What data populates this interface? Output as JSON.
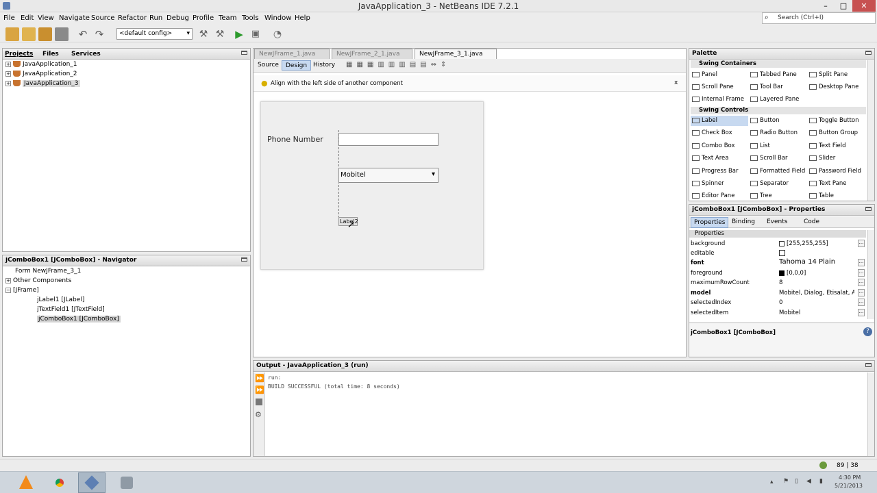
{
  "window": {
    "title": "JavaApplication_3 - NetBeans IDE 7.2.1",
    "min": "–",
    "max": "□",
    "close": "✕"
  },
  "menu": [
    "File",
    "Edit",
    "View",
    "Navigate",
    "Source",
    "Refactor",
    "Run",
    "Debug",
    "Profile",
    "Team",
    "Tools",
    "Window",
    "Help"
  ],
  "search": {
    "placeholder": "Search (Ctrl+I)"
  },
  "toolbar": {
    "config": "<default config>"
  },
  "projects": {
    "tabs": [
      "Projects",
      "Files",
      "Services"
    ],
    "items": [
      "JavaApplication_1",
      "JavaApplication_2",
      "JavaApplication_3"
    ]
  },
  "editor": {
    "tabs": [
      "NewJFrame_1.java",
      "NewJFrame_2_1.java",
      "NewJFrame_3_1.java"
    ],
    "modes": [
      "Source",
      "Design",
      "History"
    ],
    "hint": "Align with the left side of another component",
    "hint_close": "x",
    "form": {
      "phone_label": "Phone Number",
      "combo_value": "Mobitel",
      "label2": "Label2"
    }
  },
  "navigator": {
    "title": "jComboBox1 [JComboBox] - Navigator",
    "items": [
      "Form NewJFrame_3_1",
      "Other Components",
      "[JFrame]",
      "jLabel1 [JLabel]",
      "jTextField1 [JTextField]",
      "jComboBox1 [JComboBox]"
    ]
  },
  "palette": {
    "title": "Palette",
    "containers_header": "Swing Containers",
    "containers": [
      "Panel",
      "Tabbed Pane",
      "Split Pane",
      "Scroll Pane",
      "Tool Bar",
      "Desktop Pane",
      "Internal Frame",
      "Layered Pane"
    ],
    "controls_header": "Swing Controls",
    "controls": [
      "Label",
      "Button",
      "Toggle Button",
      "Check Box",
      "Radio Button",
      "Button Group",
      "Combo Box",
      "List",
      "Text Field",
      "Text Area",
      "Scroll Bar",
      "Slider",
      "Progress Bar",
      "Formatted Field",
      "Password Field",
      "Spinner",
      "Separator",
      "Text Pane",
      "Editor Pane",
      "Tree",
      "Table"
    ]
  },
  "properties": {
    "title": "jComboBox1 [JComboBox] - Properties",
    "tabs": [
      "Properties",
      "Binding",
      "Events",
      "Code"
    ],
    "section": "Properties",
    "rows": [
      {
        "name": "background",
        "value": "[255,255,255]",
        "bold": false
      },
      {
        "name": "editable",
        "value": "",
        "bold": false
      },
      {
        "name": "font",
        "value": "Tahoma 14 Plain",
        "bold": true
      },
      {
        "name": "foreground",
        "value": "[0,0,0]",
        "bold": false
      },
      {
        "name": "maximumRowCount",
        "value": "8",
        "bold": false
      },
      {
        "name": "model",
        "value": "Mobitel, Dialog, Etisalat, Ai...",
        "bold": true
      },
      {
        "name": "selectedIndex",
        "value": "0",
        "bold": false
      },
      {
        "name": "selectedItem",
        "value": "Mobitel",
        "bold": false
      }
    ],
    "footer": "jComboBox1 [JComboBox]"
  },
  "output": {
    "title": "Output - JavaApplication_3 (run)",
    "lines": [
      "run:",
      "BUILD SUCCESSFUL (total time: 8 seconds)"
    ]
  },
  "status": {
    "position": "89 | 38"
  },
  "taskbar": {
    "time": "4:30 PM",
    "date": "5/21/2013"
  },
  "colors": {
    "accent": "#3b6ea5",
    "tab_active": "#c7d9f0"
  }
}
